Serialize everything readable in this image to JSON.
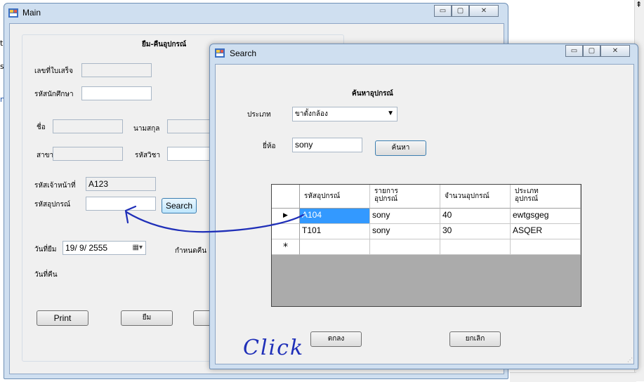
{
  "main_window": {
    "title": "Main",
    "group_title": "ยืม-คืนอุปกรณ์",
    "labels": {
      "receipt_no": "เลขที่ใบเสร็จ",
      "student_id": "รหัสนักศึกษา",
      "first_name": "ชื่อ",
      "last_name": "นามสกุล",
      "branch": "สาขา",
      "course_id": "รหัสวิชา",
      "staff_id": "รหัสเจ้าหน้าที่",
      "equipment_id": "รหัสอุปกรณ์",
      "borrow_date": "วันที่ยืม",
      "due": "กำหนดคืน",
      "return_date": "วันที่คืน"
    },
    "values": {
      "staff_id": "A123",
      "borrow_date": "19/ 9/ 2555"
    },
    "buttons": {
      "search": "Search",
      "print": "Print",
      "borrow": "ยืม"
    }
  },
  "search_window": {
    "title": "Search",
    "heading": "ค้นหาอุปกรณ์",
    "labels": {
      "type": "ประเภท",
      "brand": "ยี่ห้อ"
    },
    "type_selected": "ขาตั้งกล้อง",
    "brand_value": "sony",
    "buttons": {
      "find": "ค้นหา",
      "ok": "ตกลง",
      "cancel": "ยกเลิก"
    },
    "grid": {
      "columns": [
        "รหัสอุปกรณ์",
        "รายการ\nอุปกรณ์",
        "จำนวนอุปกรณ์",
        "ประเภท\nอุปกรณ์"
      ],
      "rows": [
        [
          "A104",
          "sony",
          "40",
          "ewtgsgeg"
        ],
        [
          "T101",
          "sony",
          "30",
          "ASQER"
        ]
      ],
      "new_row_marker": "*",
      "current_row_marker": "▶"
    }
  },
  "annotation": {
    "text": "Click",
    "color": "#1f2fb8"
  },
  "window_buttons": {
    "minimize": "▭",
    "maximize": "▢",
    "close": "✕"
  },
  "edge_glyphs": {
    "left_1": "t",
    "left_2": "s",
    "left_3": "n",
    "right_scroll": "⇞"
  }
}
